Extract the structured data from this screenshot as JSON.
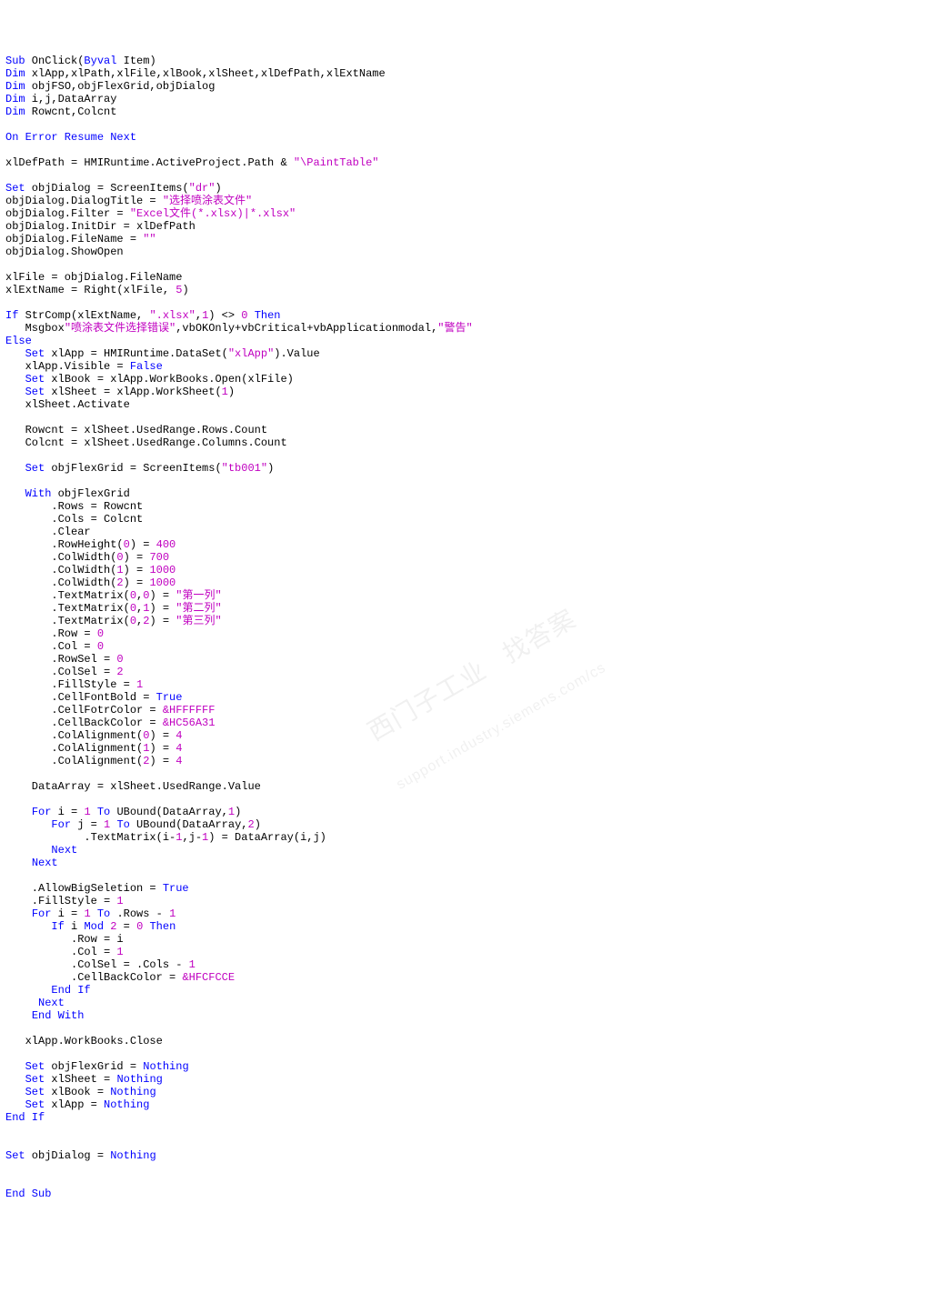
{
  "code": {
    "tokens": [
      [
        "kw",
        "Sub"
      ],
      [
        "bk",
        " OnClick("
      ],
      [
        "kw",
        "Byval"
      ],
      [
        "bk",
        " Item)\n"
      ],
      [
        "kw",
        "Dim"
      ],
      [
        "bk",
        " xlApp,xlPath,xlFile,xlBook,xlSheet,xlDefPath,xlExtName\n"
      ],
      [
        "kw",
        "Dim"
      ],
      [
        "bk",
        " objFSO,objFlexGrid,objDialog\n"
      ],
      [
        "kw",
        "Dim"
      ],
      [
        "bk",
        " i,j,DataArray\n"
      ],
      [
        "kw",
        "Dim"
      ],
      [
        "bk",
        " Rowcnt,Colcnt\n"
      ],
      [
        "bk",
        "\n"
      ],
      [
        "kw",
        "On Error Resume Next"
      ],
      [
        "bk",
        "\n"
      ],
      [
        "bk",
        "\n"
      ],
      [
        "bk",
        "xlDefPath = HMIRuntime.ActiveProject.Path & "
      ],
      [
        "str",
        "\"\\PaintTable\""
      ],
      [
        "bk",
        "\n"
      ],
      [
        "bk",
        "\n"
      ],
      [
        "kw",
        "Set"
      ],
      [
        "bk",
        " objDialog = ScreenItems("
      ],
      [
        "str",
        "\"dr\""
      ],
      [
        "bk",
        ")\n"
      ],
      [
        "bk",
        "objDialog.DialogTitle = "
      ],
      [
        "str",
        "\"选择喷涂表文件\""
      ],
      [
        "bk",
        "\n"
      ],
      [
        "bk",
        "objDialog.Filter = "
      ],
      [
        "str",
        "\"Excel文件(*.xlsx)|*.xlsx\""
      ],
      [
        "bk",
        "\n"
      ],
      [
        "bk",
        "objDialog.InitDir = xlDefPath\n"
      ],
      [
        "bk",
        "objDialog.FileName = "
      ],
      [
        "str",
        "\"\""
      ],
      [
        "bk",
        "\n"
      ],
      [
        "bk",
        "objDialog.ShowOpen\n"
      ],
      [
        "bk",
        "\n"
      ],
      [
        "bk",
        "xlFile = objDialog.FileName\n"
      ],
      [
        "bk",
        "xlExtName = Right(xlFile, "
      ],
      [
        "num",
        "5"
      ],
      [
        "bk",
        ")\n"
      ],
      [
        "bk",
        "\n"
      ],
      [
        "kw",
        "If"
      ],
      [
        "bk",
        " StrComp(xlExtName, "
      ],
      [
        "str",
        "\".xlsx\""
      ],
      [
        "bk",
        ","
      ],
      [
        "num",
        "1"
      ],
      [
        "bk",
        ") <> "
      ],
      [
        "num",
        "0"
      ],
      [
        "bk",
        " "
      ],
      [
        "kw",
        "Then"
      ],
      [
        "bk",
        "\n"
      ],
      [
        "bk",
        "   Msgbox"
      ],
      [
        "str",
        "\"喷涂表文件选择错误\""
      ],
      [
        "bk",
        ",vbOKOnly+vbCritical+vbApplicationmodal,"
      ],
      [
        "str",
        "\"警告\""
      ],
      [
        "bk",
        "\n"
      ],
      [
        "kw",
        "Else"
      ],
      [
        "bk",
        "\n"
      ],
      [
        "bk",
        "   "
      ],
      [
        "kw",
        "Set"
      ],
      [
        "bk",
        " xlApp = HMIRuntime.DataSet("
      ],
      [
        "str",
        "\"xlApp\""
      ],
      [
        "bk",
        ").Value\n"
      ],
      [
        "bk",
        "   xlApp.Visible = "
      ],
      [
        "kw",
        "False"
      ],
      [
        "bk",
        "\n"
      ],
      [
        "bk",
        "   "
      ],
      [
        "kw",
        "Set"
      ],
      [
        "bk",
        " xlBook = xlApp.WorkBooks.Open(xlFile)\n"
      ],
      [
        "bk",
        "   "
      ],
      [
        "kw",
        "Set"
      ],
      [
        "bk",
        " xlSheet = xlApp.WorkSheet("
      ],
      [
        "num",
        "1"
      ],
      [
        "bk",
        ")\n"
      ],
      [
        "bk",
        "   xlSheet.Activate\n"
      ],
      [
        "bk",
        "\n"
      ],
      [
        "bk",
        "   Rowcnt = xlSheet.UsedRange.Rows.Count\n"
      ],
      [
        "bk",
        "   Colcnt = xlSheet.UsedRange.Columns.Count\n"
      ],
      [
        "bk",
        "\n"
      ],
      [
        "bk",
        "   "
      ],
      [
        "kw",
        "Set"
      ],
      [
        "bk",
        " objFlexGrid = ScreenItems("
      ],
      [
        "str",
        "\"tb001\""
      ],
      [
        "bk",
        ")\n"
      ],
      [
        "bk",
        "\n"
      ],
      [
        "bk",
        "   "
      ],
      [
        "kw",
        "With"
      ],
      [
        "bk",
        " objFlexGrid\n"
      ],
      [
        "bk",
        "       .Rows = Rowcnt\n"
      ],
      [
        "bk",
        "       .Cols = Colcnt\n"
      ],
      [
        "bk",
        "       .Clear\n"
      ],
      [
        "bk",
        "       .RowHeight("
      ],
      [
        "num",
        "0"
      ],
      [
        "bk",
        ") = "
      ],
      [
        "num",
        "400"
      ],
      [
        "bk",
        "\n"
      ],
      [
        "bk",
        "       .ColWidth("
      ],
      [
        "num",
        "0"
      ],
      [
        "bk",
        ") = "
      ],
      [
        "num",
        "700"
      ],
      [
        "bk",
        "\n"
      ],
      [
        "bk",
        "       .ColWidth("
      ],
      [
        "num",
        "1"
      ],
      [
        "bk",
        ") = "
      ],
      [
        "num",
        "1000"
      ],
      [
        "bk",
        "\n"
      ],
      [
        "bk",
        "       .ColWidth("
      ],
      [
        "num",
        "2"
      ],
      [
        "bk",
        ") = "
      ],
      [
        "num",
        "1000"
      ],
      [
        "bk",
        "\n"
      ],
      [
        "bk",
        "       .TextMatrix("
      ],
      [
        "num",
        "0"
      ],
      [
        "bk",
        ","
      ],
      [
        "num",
        "0"
      ],
      [
        "bk",
        ") = "
      ],
      [
        "str",
        "\"第一列\""
      ],
      [
        "bk",
        "\n"
      ],
      [
        "bk",
        "       .TextMatrix("
      ],
      [
        "num",
        "0"
      ],
      [
        "bk",
        ","
      ],
      [
        "num",
        "1"
      ],
      [
        "bk",
        ") = "
      ],
      [
        "str",
        "\"第二列\""
      ],
      [
        "bk",
        "\n"
      ],
      [
        "bk",
        "       .TextMatrix("
      ],
      [
        "num",
        "0"
      ],
      [
        "bk",
        ","
      ],
      [
        "num",
        "2"
      ],
      [
        "bk",
        ") = "
      ],
      [
        "str",
        "\"第三列\""
      ],
      [
        "bk",
        "\n"
      ],
      [
        "bk",
        "       .Row = "
      ],
      [
        "num",
        "0"
      ],
      [
        "bk",
        "\n"
      ],
      [
        "bk",
        "       .Col = "
      ],
      [
        "num",
        "0"
      ],
      [
        "bk",
        "\n"
      ],
      [
        "bk",
        "       .RowSel = "
      ],
      [
        "num",
        "0"
      ],
      [
        "bk",
        "\n"
      ],
      [
        "bk",
        "       .ColSel = "
      ],
      [
        "num",
        "2"
      ],
      [
        "bk",
        "\n"
      ],
      [
        "bk",
        "       .FillStyle = "
      ],
      [
        "num",
        "1"
      ],
      [
        "bk",
        "\n"
      ],
      [
        "bk",
        "       .CellFontBold = "
      ],
      [
        "kw",
        "True"
      ],
      [
        "bk",
        "\n"
      ],
      [
        "bk",
        "       .CellFotrColor = "
      ],
      [
        "hx",
        "&HFFFFFF"
      ],
      [
        "bk",
        "\n"
      ],
      [
        "bk",
        "       .CellBackColor = "
      ],
      [
        "hx",
        "&HC56A31"
      ],
      [
        "bk",
        "\n"
      ],
      [
        "bk",
        "       .ColAlignment("
      ],
      [
        "num",
        "0"
      ],
      [
        "bk",
        ") = "
      ],
      [
        "num",
        "4"
      ],
      [
        "bk",
        "\n"
      ],
      [
        "bk",
        "       .ColAlignment("
      ],
      [
        "num",
        "1"
      ],
      [
        "bk",
        ") = "
      ],
      [
        "num",
        "4"
      ],
      [
        "bk",
        "\n"
      ],
      [
        "bk",
        "       .ColAlignment("
      ],
      [
        "num",
        "2"
      ],
      [
        "bk",
        ") = "
      ],
      [
        "num",
        "4"
      ],
      [
        "bk",
        "\n"
      ],
      [
        "bk",
        "\n"
      ],
      [
        "bk",
        "    DataArray = xlSheet.UsedRange.Value\n"
      ],
      [
        "bk",
        "\n"
      ],
      [
        "bk",
        "    "
      ],
      [
        "kw",
        "For"
      ],
      [
        "bk",
        " i = "
      ],
      [
        "num",
        "1"
      ],
      [
        "bk",
        " "
      ],
      [
        "kw",
        "To"
      ],
      [
        "bk",
        " UBound(DataArray,"
      ],
      [
        "num",
        "1"
      ],
      [
        "bk",
        ")\n"
      ],
      [
        "bk",
        "       "
      ],
      [
        "kw",
        "For"
      ],
      [
        "bk",
        " j = "
      ],
      [
        "num",
        "1"
      ],
      [
        "bk",
        " "
      ],
      [
        "kw",
        "To"
      ],
      [
        "bk",
        " UBound(DataArray,"
      ],
      [
        "num",
        "2"
      ],
      [
        "bk",
        ")\n"
      ],
      [
        "bk",
        "            .TextMatrix(i-"
      ],
      [
        "num",
        "1"
      ],
      [
        "bk",
        ",j-"
      ],
      [
        "num",
        "1"
      ],
      [
        "bk",
        ") = DataArray(i,j)\n"
      ],
      [
        "bk",
        "       "
      ],
      [
        "kw",
        "Next"
      ],
      [
        "bk",
        "\n"
      ],
      [
        "bk",
        "    "
      ],
      [
        "kw",
        "Next"
      ],
      [
        "bk",
        "\n"
      ],
      [
        "bk",
        "\n"
      ],
      [
        "bk",
        "    .AllowBigSeletion = "
      ],
      [
        "kw",
        "True"
      ],
      [
        "bk",
        "\n"
      ],
      [
        "bk",
        "    .FillStyle = "
      ],
      [
        "num",
        "1"
      ],
      [
        "bk",
        "\n"
      ],
      [
        "bk",
        "    "
      ],
      [
        "kw",
        "For"
      ],
      [
        "bk",
        " i = "
      ],
      [
        "num",
        "1"
      ],
      [
        "bk",
        " "
      ],
      [
        "kw",
        "To"
      ],
      [
        "bk",
        " .Rows - "
      ],
      [
        "num",
        "1"
      ],
      [
        "bk",
        "\n"
      ],
      [
        "bk",
        "       "
      ],
      [
        "kw",
        "If"
      ],
      [
        "bk",
        " i "
      ],
      [
        "kw",
        "Mod"
      ],
      [
        "bk",
        " "
      ],
      [
        "num",
        "2"
      ],
      [
        "bk",
        " = "
      ],
      [
        "num",
        "0"
      ],
      [
        "bk",
        " "
      ],
      [
        "kw",
        "Then"
      ],
      [
        "bk",
        "\n"
      ],
      [
        "bk",
        "          .Row = i\n"
      ],
      [
        "bk",
        "          .Col = "
      ],
      [
        "num",
        "1"
      ],
      [
        "bk",
        "\n"
      ],
      [
        "bk",
        "          .ColSel = .Cols - "
      ],
      [
        "num",
        "1"
      ],
      [
        "bk",
        "\n"
      ],
      [
        "bk",
        "          .CellBackColor = "
      ],
      [
        "hx",
        "&HFCFCCE"
      ],
      [
        "bk",
        "\n"
      ],
      [
        "bk",
        "       "
      ],
      [
        "kw",
        "End If"
      ],
      [
        "bk",
        "\n"
      ],
      [
        "bk",
        "     "
      ],
      [
        "kw",
        "Next"
      ],
      [
        "bk",
        "\n"
      ],
      [
        "bk",
        "    "
      ],
      [
        "kw",
        "End With"
      ],
      [
        "bk",
        "\n"
      ],
      [
        "bk",
        "\n"
      ],
      [
        "bk",
        "   xlApp.WorkBooks.Close\n"
      ],
      [
        "bk",
        "\n"
      ],
      [
        "bk",
        "   "
      ],
      [
        "kw",
        "Set"
      ],
      [
        "bk",
        " objFlexGrid = "
      ],
      [
        "kw",
        "Nothing"
      ],
      [
        "bk",
        "\n"
      ],
      [
        "bk",
        "   "
      ],
      [
        "kw",
        "Set"
      ],
      [
        "bk",
        " xlSheet = "
      ],
      [
        "kw",
        "Nothing"
      ],
      [
        "bk",
        "\n"
      ],
      [
        "bk",
        "   "
      ],
      [
        "kw",
        "Set"
      ],
      [
        "bk",
        " xlBook = "
      ],
      [
        "kw",
        "Nothing"
      ],
      [
        "bk",
        "\n"
      ],
      [
        "bk",
        "   "
      ],
      [
        "kw",
        "Set"
      ],
      [
        "bk",
        " xlApp = "
      ],
      [
        "kw",
        "Nothing"
      ],
      [
        "bk",
        "\n"
      ],
      [
        "kw",
        "End If"
      ],
      [
        "bk",
        "\n"
      ],
      [
        "bk",
        "\n"
      ],
      [
        "bk",
        "\n"
      ],
      [
        "kw",
        "Set"
      ],
      [
        "bk",
        " objDialog = "
      ],
      [
        "kw",
        "Nothing"
      ],
      [
        "bk",
        "\n"
      ],
      [
        "bk",
        "\n"
      ],
      [
        "bk",
        "\n"
      ],
      [
        "kw",
        "End Sub"
      ],
      [
        "bk",
        "\n"
      ]
    ]
  },
  "watermark": {
    "line1": "西门子工业   找答案",
    "line2": "support.industry.siemens.com/cs"
  }
}
